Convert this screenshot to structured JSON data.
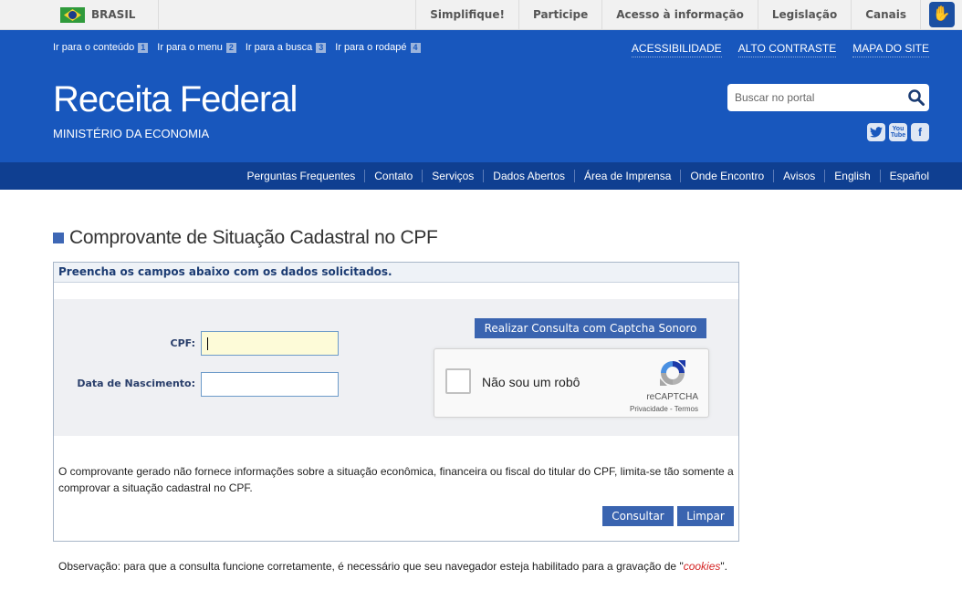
{
  "gov_bar": {
    "brasil_label": "BRASIL",
    "links": [
      "Simplifique!",
      "Participe",
      "Acesso à informação",
      "Legislação",
      "Canais"
    ],
    "accessibility_icon": "sign-language-icon"
  },
  "header": {
    "skip_links": [
      {
        "label": "Ir para o conteúdo",
        "key": "1"
      },
      {
        "label": "Ir para o menu",
        "key": "2"
      },
      {
        "label": "Ir para a busca",
        "key": "3"
      },
      {
        "label": "Ir para o rodapé",
        "key": "4"
      }
    ],
    "a11y_links": [
      "ACESSIBILIDADE",
      "ALTO CONTRASTE",
      "MAPA DO SITE"
    ],
    "title": "Receita Federal",
    "subtitle": "MINISTÉRIO DA ECONOMIA",
    "search": {
      "placeholder": "Buscar no portal",
      "value": ""
    },
    "social": [
      {
        "name": "twitter-icon",
        "glyph": "t"
      },
      {
        "name": "youtube-icon",
        "glyph_top": "You",
        "glyph_bottom": "Tube"
      },
      {
        "name": "facebook-icon",
        "glyph": "f"
      }
    ]
  },
  "nav": {
    "items": [
      "Perguntas Frequentes",
      "Contato",
      "Serviços",
      "Dados Abertos",
      "Área de Imprensa",
      "Onde Encontro",
      "Avisos",
      "English",
      "Español"
    ]
  },
  "page": {
    "heading": "Comprovante de Situação Cadastral no CPF",
    "instructions": "Preencha os campos abaixo com os dados solicitados.",
    "fields": {
      "cpf": {
        "label": "CPF:",
        "value": ""
      },
      "birth_date": {
        "label": "Data de Nascimento:",
        "value": ""
      }
    },
    "audio_captcha_button": "Realizar Consulta com Captcha Sonoro",
    "recaptcha": {
      "label": "Não sou um robô",
      "brand": "reCAPTCHA",
      "terms": "Privacidade - Termos",
      "checked": false
    },
    "disclaimer": "O comprovante gerado não fornece informações sobre a situação econômica, financeira ou fiscal do titular do CPF, limita-se tão somente a comprovar a situação cadastral no CPF.",
    "buttons": {
      "submit": "Consultar",
      "clear": "Limpar"
    },
    "note_prefix": "Observação: para que a consulta funcione corretamente, é necessário que seu navegador esteja habilitado para a gravação de \"",
    "note_highlight": "cookies",
    "note_suffix": "\"."
  },
  "colors": {
    "header_blue": "#1857bd",
    "nav_blue": "#0f3f91",
    "button_blue": "#3a64b0",
    "cookies_red": "#d42424"
  }
}
